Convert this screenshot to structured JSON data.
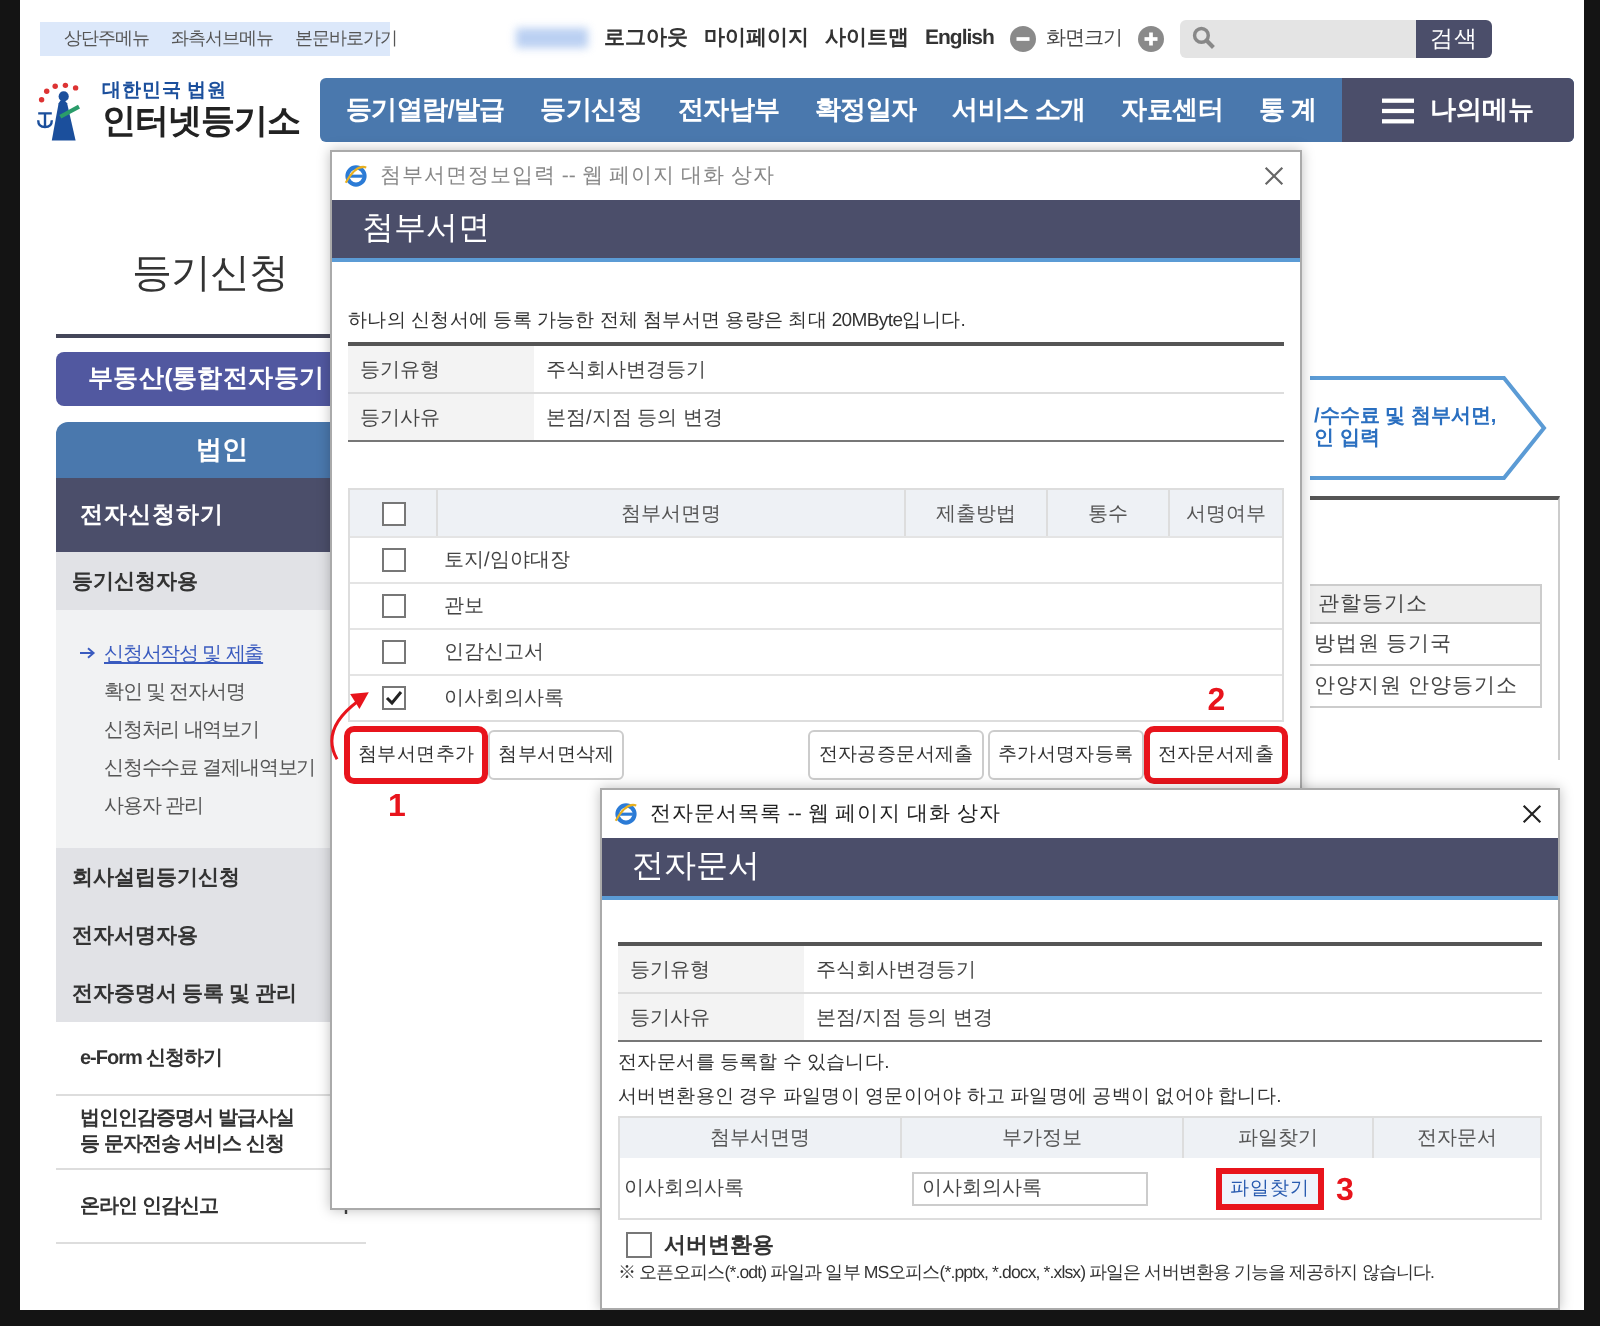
{
  "skip_links": [
    "상단주메뉴",
    "좌측서브메뉴",
    "본문바로가기"
  ],
  "util_links": [
    "로그아웃",
    "마이페이지",
    "사이트맵",
    "English"
  ],
  "zoom_label": "화면크기",
  "search": {
    "button": "검색"
  },
  "logo": {
    "top": "대한민국 법원",
    "name": "인터넷등기소"
  },
  "nav": {
    "items": [
      "등기열람/발급",
      "등기신청",
      "전자납부",
      "확정일자",
      "서비스 소개",
      "자료센터",
      "통 계"
    ],
    "my_menu": "나의메뉴"
  },
  "sidebar": {
    "title": "등기신청",
    "category": "부동산(통합전자등기",
    "tab": "법인",
    "items": [
      {
        "kind": "header",
        "label": "전자신청하기"
      },
      {
        "kind": "group",
        "label": "등기신청자용"
      },
      {
        "kind": "links",
        "children": [
          {
            "label": "신청서작성 및 제출",
            "selected": true
          },
          {
            "label": "확인 및 전자서명",
            "selected": false
          },
          {
            "label": "신청처리 내역보기",
            "selected": false
          },
          {
            "label": "신청수수료 결제내역보기",
            "selected": false
          },
          {
            "label": "사용자 관리",
            "selected": false
          }
        ]
      },
      {
        "kind": "group",
        "label": "회사설립등기신청"
      },
      {
        "kind": "group",
        "label": "전자서명자용"
      },
      {
        "kind": "group",
        "label": "전자증명서 등록 및 관리"
      },
      {
        "kind": "plain",
        "label": "e-Form 신청하기"
      },
      {
        "kind": "plain",
        "label": "법인인감증명서 발급사실\n등 문자전송 서비스 신청"
      },
      {
        "kind": "plain",
        "label": "온라인 인감신고",
        "expandable": true
      }
    ]
  },
  "right_panel": {
    "step_text": "/수수료 및 첨부서면,\n인 입력",
    "office_table": {
      "header": "관할등기소",
      "rows": [
        "방법원 등기국",
        "안양지원 안양등기소"
      ]
    }
  },
  "dialog_attach": {
    "window_title": "첨부서면정보입력 -- 웹 페이지 대화 상자",
    "heading": "첨부서면",
    "notice": "하나의 신청서에 등록 가능한 전체 첨부서면 용량은 최대 20MByte입니다.",
    "info": [
      {
        "label": "등기유형",
        "value": "주식회사변경등기"
      },
      {
        "label": "등기사유",
        "value": "본점/지점 등의 변경"
      }
    ],
    "table": {
      "all_checked": false,
      "columns": [
        "첨부서면명",
        "제출방법",
        "통수",
        "서명여부"
      ],
      "rows": [
        {
          "name": "토지/임야대장",
          "checked": false
        },
        {
          "name": "관보",
          "checked": false
        },
        {
          "name": "인감신고서",
          "checked": false
        },
        {
          "name": "이사회의사록",
          "checked": true
        }
      ]
    },
    "buttons_left": [
      {
        "label": "첨부서면추가",
        "highlighted": true,
        "marker": "1"
      },
      {
        "label": "첨부서면삭제",
        "highlighted": false
      }
    ],
    "buttons_right": [
      {
        "label": "전자공증문서제출",
        "highlighted": false
      },
      {
        "label": "추가서명자등록",
        "highlighted": false
      },
      {
        "label": "전자문서제출",
        "highlighted": true,
        "marker": "2"
      }
    ]
  },
  "dialog_edoc": {
    "window_title": "전자문서목록 -- 웹 페이지 대화 상자",
    "heading": "전자문서",
    "info": [
      {
        "label": "등기유형",
        "value": "주식회사변경등기"
      },
      {
        "label": "등기사유",
        "value": "본점/지점 등의 변경"
      }
    ],
    "notes": [
      "전자문서를 등록할 수 있습니다.",
      "서버변환용인 경우 파일명이 영문이어야 하고 파일명에 공백이 없어야 합니다."
    ],
    "table": {
      "columns": [
        "첨부서면명",
        "부가정보",
        "파일찾기",
        "전자문서"
      ],
      "rows": [
        {
          "name": "이사회의사록",
          "info_value": "이사회의사록",
          "button": {
            "label": "파일찾기",
            "highlighted": true,
            "marker": "3"
          }
        }
      ]
    },
    "server_convert": {
      "label": "서버변환용",
      "checked": false
    },
    "footnote": "※ 오픈오피스(*.odt) 파일과 일부 MS오피스(*.pptx, *.docx, *.xlsx) 파일은 서버변환용 기능을 제공하지 않습니다."
  }
}
